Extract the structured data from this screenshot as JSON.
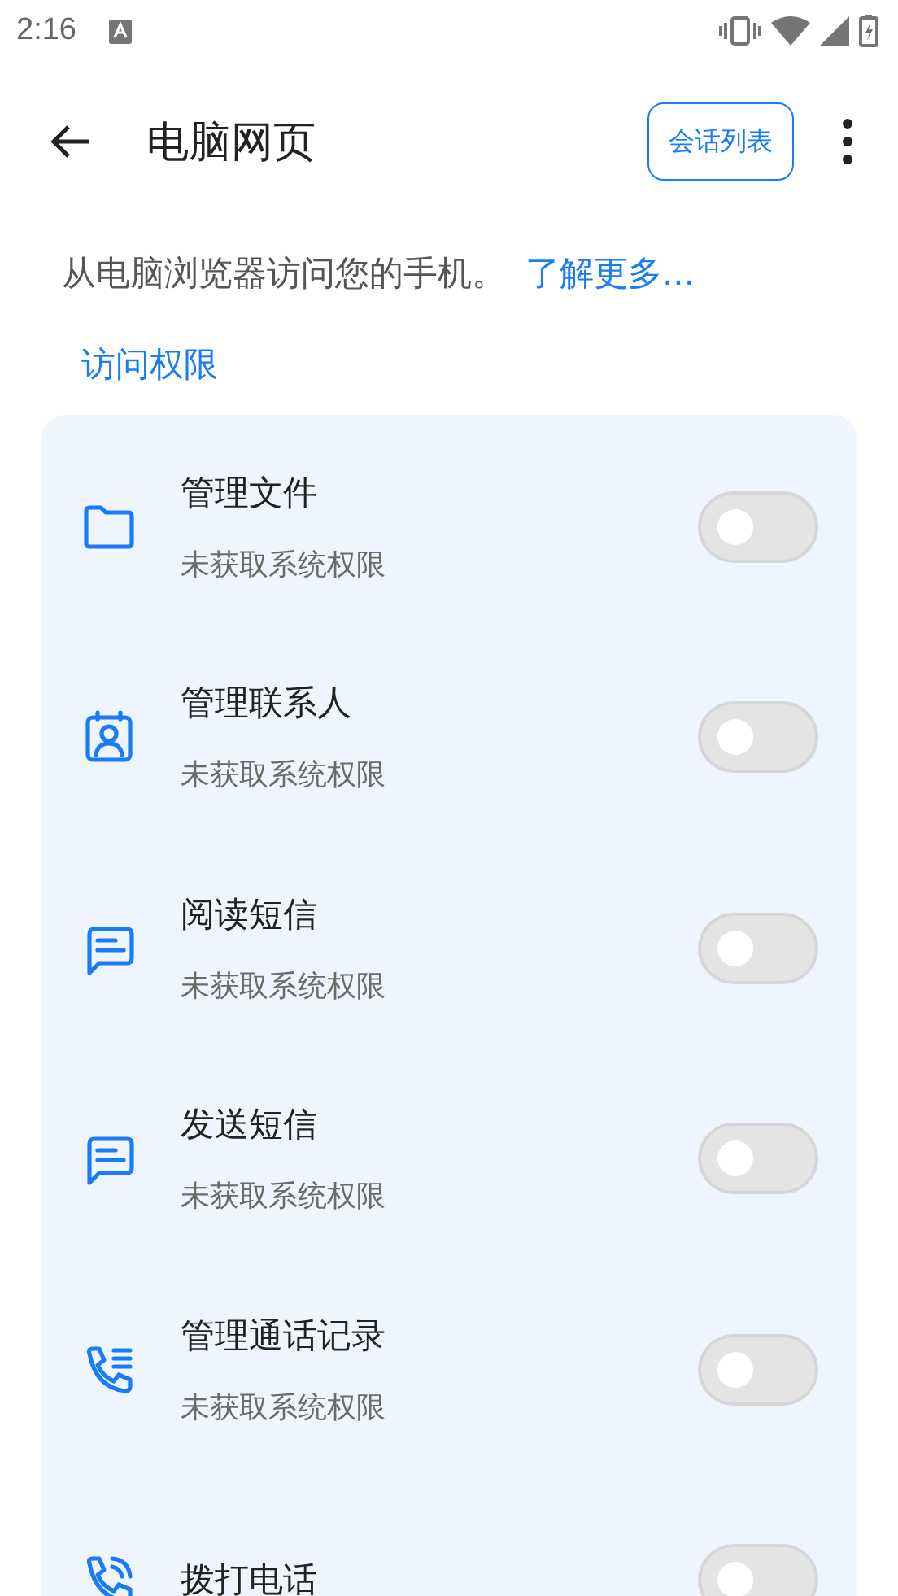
{
  "status_bar": {
    "time": "2:16"
  },
  "app_bar": {
    "title": "电脑网页",
    "action_button": "会话列表"
  },
  "description": {
    "text": "从电脑浏览器访问您的手机。",
    "link": "了解更多..."
  },
  "section_title": "访问权限",
  "permissions": [
    {
      "kind": "folder",
      "title": "管理文件",
      "subtitle": "未获取系统权限",
      "on": false
    },
    {
      "kind": "contact",
      "title": "管理联系人",
      "subtitle": "未获取系统权限",
      "on": false
    },
    {
      "kind": "message",
      "title": "阅读短信",
      "subtitle": "未获取系统权限",
      "on": false
    },
    {
      "kind": "message",
      "title": "发送短信",
      "subtitle": "未获取系统权限",
      "on": false
    },
    {
      "kind": "call-log",
      "title": "管理通话记录",
      "subtitle": "未获取系统权限",
      "on": false
    },
    {
      "kind": "phone",
      "title": "拨打电话",
      "on": false
    }
  ]
}
